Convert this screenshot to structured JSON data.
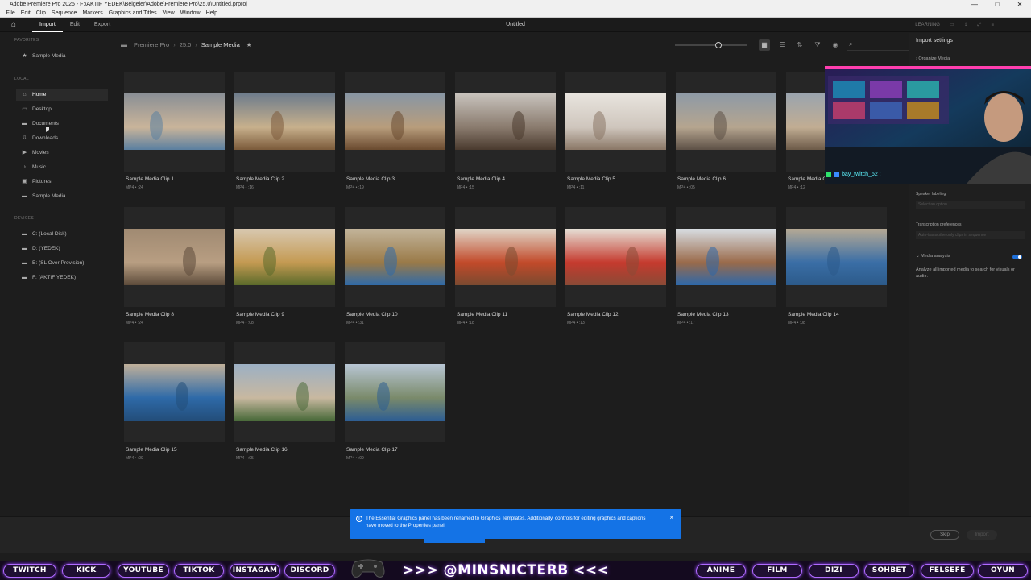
{
  "window": {
    "title": "Adobe Premiere Pro 2025 - F:\\AKTIF YEDEK\\Belgeler\\Adobe\\Premiere Pro\\25.0\\Untitled.prproj",
    "controls": [
      "—",
      "□",
      "✕"
    ]
  },
  "menu": [
    "File",
    "Edit",
    "Clip",
    "Sequence",
    "Markers",
    "Graphics and Titles",
    "View",
    "Window",
    "Help"
  ],
  "app_header": {
    "tabs": [
      "Import",
      "Edit",
      "Export"
    ],
    "active_tab": "Import",
    "document": "Untitled",
    "right_label": "LEARNING"
  },
  "sidebar": {
    "favorites_heading": "FAVORITES",
    "favorites": [
      {
        "label": "Sample Media",
        "icon": "star-icon"
      }
    ],
    "local_heading": "LOCAL",
    "local": [
      {
        "label": "Home",
        "icon": "home-icon"
      },
      {
        "label": "Desktop",
        "icon": "desktop-icon"
      },
      {
        "label": "Documents",
        "icon": "folder-icon"
      },
      {
        "label": "Downloads",
        "icon": "download-icon"
      },
      {
        "label": "Movies",
        "icon": "film-icon"
      },
      {
        "label": "Music",
        "icon": "music-icon"
      },
      {
        "label": "Pictures",
        "icon": "image-icon"
      },
      {
        "label": "Sample Media",
        "icon": "folder-icon"
      }
    ],
    "devices_heading": "DEVICES",
    "devices": [
      {
        "label": "C: (Local Disk)",
        "icon": "drive-icon"
      },
      {
        "label": "D: (YEDEK)",
        "icon": "drive-icon"
      },
      {
        "label": "E: (SL Over Provision)",
        "icon": "drive-icon"
      },
      {
        "label": "F: (AKTIF YEDEK)",
        "icon": "drive-icon"
      }
    ]
  },
  "breadcrumb": [
    "Premiere Pro",
    "25.0",
    "Sample Media"
  ],
  "search": {
    "placeholder": ""
  },
  "clips": [
    {
      "name": "Sample Media Clip 1",
      "meta": "MP4 • :24",
      "c1": "#8a8f95",
      "c2": "#c9b49a",
      "c3": "#5a7fa0"
    },
    {
      "name": "Sample Media Clip 2",
      "meta": "MP4 • :16",
      "c1": "#6e7c8c",
      "c2": "#c7b08c",
      "c3": "#7b5a3a"
    },
    {
      "name": "Sample Media Clip 3",
      "meta": "MP4 • :19",
      "c1": "#8896a4",
      "c2": "#b89d7c",
      "c3": "#6a4a2f"
    },
    {
      "name": "Sample Media Clip 4",
      "meta": "MP4 • :15",
      "c1": "#c8c3bd",
      "c2": "#8a7b6e",
      "c3": "#4a3a2e"
    },
    {
      "name": "Sample Media Clip 5",
      "meta": "MP4 • :11",
      "c1": "#e8e4de",
      "c2": "#cfc6bd",
      "c3": "#8a7766"
    },
    {
      "name": "Sample Media Clip 6",
      "meta": "MP4 • :05",
      "c1": "#8e9aa6",
      "c2": "#b5a58f",
      "c3": "#5d5046"
    },
    {
      "name": "Sample Media Clip 7",
      "meta": "MP4 • :12",
      "c1": "#9aa4ae",
      "c2": "#c1ad93",
      "c3": "#6c5a48"
    },
    {
      "name": "Sample Media Clip 8",
      "meta": "MP4 • :24",
      "c1": "#a08a72",
      "c2": "#b89e82",
      "c3": "#5c4a3a"
    },
    {
      "name": "Sample Media Clip 9",
      "meta": "MP4 • :08",
      "c1": "#d8c8b0",
      "c2": "#c49a52",
      "c3": "#5a6a2a"
    },
    {
      "name": "Sample Media Clip 10",
      "meta": "MP4 • :31",
      "c1": "#c2b49a",
      "c2": "#9a7a48",
      "c3": "#2f6aa8"
    },
    {
      "name": "Sample Media Clip 11",
      "meta": "MP4 • :18",
      "c1": "#e0d6c8",
      "c2": "#c24a2a",
      "c3": "#7a4a30"
    },
    {
      "name": "Sample Media Clip 12",
      "meta": "MP4 • :13",
      "c1": "#e6e0d6",
      "c2": "#c53a2e",
      "c3": "#8a4a36"
    },
    {
      "name": "Sample Media Clip 13",
      "meta": "MP4 • :17",
      "c1": "#d8dde2",
      "c2": "#9a6a4a",
      "c3": "#2d68aa"
    },
    {
      "name": "Sample Media Clip 14",
      "meta": "MP4 • :08",
      "c1": "#b5a994",
      "c2": "#3a6ea6",
      "c3": "#2c5a8a"
    },
    {
      "name": "Sample Media Clip 15",
      "meta": "MP4 • :09",
      "c1": "#c0b09a",
      "c2": "#2e6aa8",
      "c3": "#234e7a"
    },
    {
      "name": "Sample Media Clip 16",
      "meta": "MP4 • :05",
      "c1": "#9cb0c4",
      "c2": "#c8b8a0",
      "c3": "#4a6a3a"
    },
    {
      "name": "Sample Media Clip 17",
      "meta": "MP4 • :09",
      "c1": "#b8c6d4",
      "c2": "#7a8a6a",
      "c3": "#2e5e92"
    }
  ],
  "import_settings": {
    "title": "Import settings",
    "organize": "Organize Media",
    "speaker_label": "Speaker labeling",
    "speaker_select": "Select an option",
    "transcription_label": "Transcription preferences",
    "transcription_select": "Auto-transcribe only clips in sequence",
    "media_analysis": "Media analysis",
    "media_analysis_enabled": true,
    "media_analysis_desc": "Analyze all imported media to search for visuals or audio."
  },
  "footer": {
    "skip": "Skip",
    "import": "Import"
  },
  "toast": {
    "message": "The Essential Graphics panel has been renamed to Graphics Templates. Additionally, controls for editing graphics and captions have moved to the Properties panel.",
    "close": "×"
  },
  "overlay": {
    "cam_name": "bay_twitch_52 :",
    "handle": ">>> @MINSNICTERB <<<",
    "left_buttons": [
      "TWITCH",
      "KICK",
      "YOUTUBE",
      "TIKTOK",
      "INSTAGAM",
      "DISCORD"
    ],
    "right_buttons": [
      "ANIME",
      "FILM",
      "DIZI",
      "SOHBET",
      "FELSEFE",
      "OYUN"
    ]
  }
}
